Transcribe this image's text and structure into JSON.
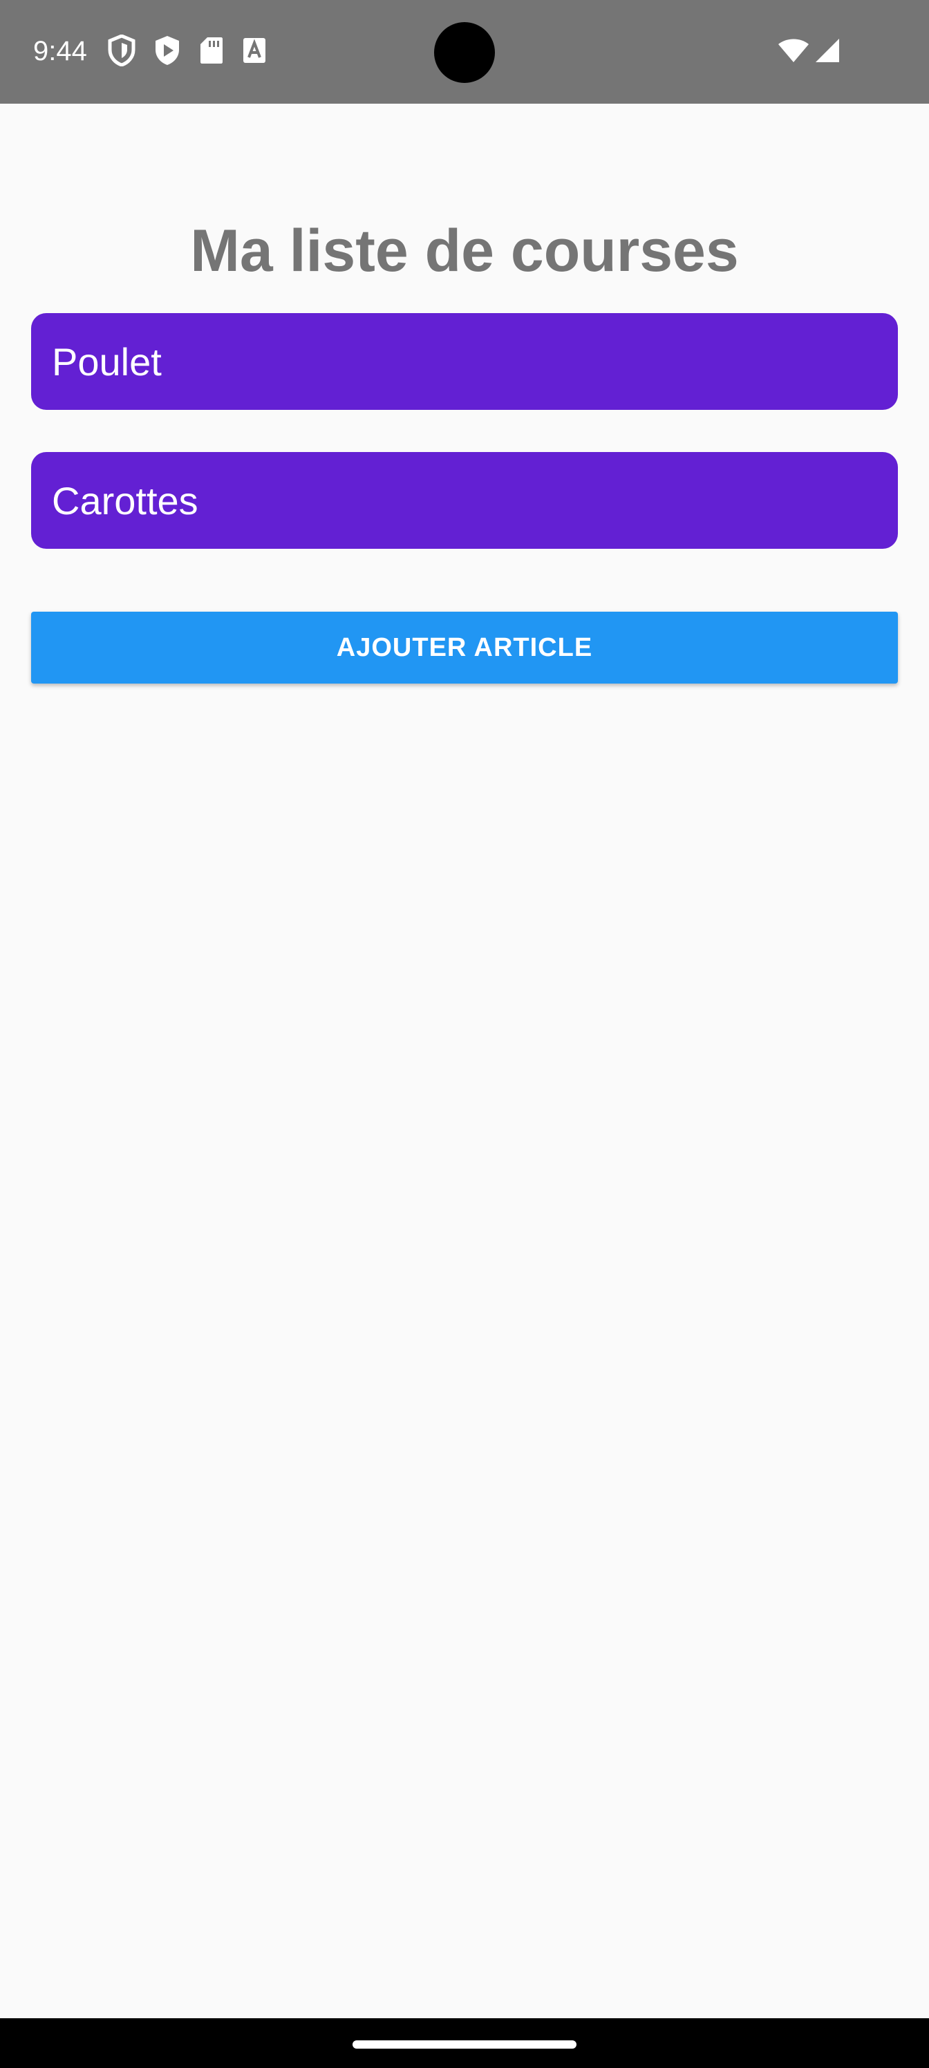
{
  "status_bar": {
    "time": "9:44",
    "left_icons": [
      "shield-icon",
      "play-protect-icon",
      "sd-card-icon",
      "text-a-icon"
    ],
    "right_icons": [
      "wifi-icon",
      "cell-signal-icon"
    ],
    "background_color": "#757575"
  },
  "main": {
    "title": "Ma liste de courses",
    "title_color": "#757575",
    "items": [
      {
        "label": "Poulet"
      },
      {
        "label": "Carottes"
      }
    ],
    "item_color": "#6320d3",
    "add_button_label": "AJOUTER ARTICLE",
    "add_button_color": "#2196f3"
  },
  "nav_bar": {
    "handle": "home-handle"
  }
}
